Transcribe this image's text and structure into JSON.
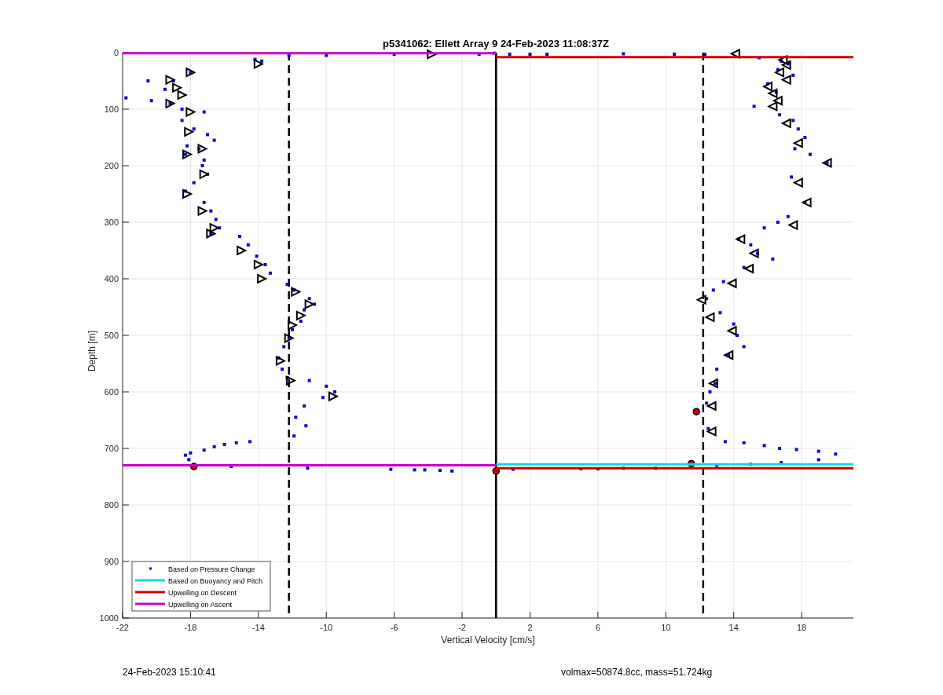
{
  "figure": {
    "footer_left": "24-Feb-2023 15:10:41",
    "footer_right": "volmax=50874.8cc, mass=51.724kg",
    "chart_data": {
      "type": "scatter",
      "title": "p5341062: Ellett Array 9 24-Feb-2023 11:08:37Z",
      "xlabel": "Vertical Velocity [cm/s]",
      "ylabel": "Depth [m]",
      "xlim": [
        -22,
        21.05
      ],
      "ylim": [
        1000,
        0
      ],
      "xticks": [
        -22,
        -18,
        -14,
        -10,
        -6,
        -2,
        2,
        6,
        10,
        14,
        18
      ],
      "yticks": [
        0,
        100,
        200,
        300,
        400,
        500,
        600,
        700,
        800,
        900,
        1000
      ],
      "series": [
        {
          "name": "Based on Pressure Change",
          "type": "scatter",
          "color": "#0a0ad0",
          "x": [
            -13.8,
            -14.2,
            -12.2,
            -18,
            -19,
            -20.5,
            -19.5,
            -21.8,
            -20.3,
            -19.2,
            -18.5,
            -17.2,
            -18.5,
            -17.8,
            -17,
            -16.6,
            -18.2,
            -17.5,
            -18.3,
            -17.2,
            -17.3,
            -17,
            -17.8,
            -18.3,
            -17.2,
            -16.8,
            -16.5,
            -16.3,
            -16.8,
            -15.1,
            -14.6,
            -14.1,
            -13.6,
            -13.3,
            -12.3,
            -11.9,
            -11,
            -10.7,
            -11.3,
            -11.5,
            -12,
            -12.2,
            -12.5,
            -12.8,
            -12.6,
            -12.3,
            -11,
            -10,
            -9.5,
            -10.2,
            -11.3,
            -11.8,
            -11.2,
            -11.9,
            -14.5,
            -15.3,
            -16,
            -16.6,
            -17.2,
            -18,
            -18.3,
            -18.1,
            -15.6,
            -11.1,
            -6.2,
            -4.8,
            -4.2,
            -3.3,
            -2.6,
            -0.1,
            -1,
            -6,
            -10,
            0.8,
            2,
            3,
            7.5,
            10.5,
            12.3,
            15.5,
            16.8,
            17.2,
            16.6,
            17.5,
            16,
            16.5,
            15.2,
            16.7,
            17.5,
            17.8,
            18.2,
            17.6,
            18.5,
            19.5,
            17.4,
            18.2,
            17.2,
            16.6,
            15.8,
            14.3,
            15,
            15.4,
            16.3,
            14.6,
            13.4,
            12.8,
            12.4,
            13.2,
            14,
            14.2,
            14.6,
            13.7,
            13,
            12.9,
            12.6,
            12.4,
            12.5,
            13.5,
            14.6,
            15.8,
            16.7,
            17.7,
            19,
            20,
            19,
            16.8,
            15,
            13,
            9.4,
            7.5,
            6,
            5,
            1
          ],
          "values": [
            15,
            12,
            5,
            35,
            50,
            50,
            65,
            80,
            85,
            90,
            100,
            105,
            120,
            135,
            145,
            155,
            165,
            170,
            180,
            190,
            200,
            215,
            230,
            245,
            265,
            280,
            295,
            310,
            320,
            325,
            340,
            360,
            375,
            390,
            410,
            420,
            435,
            445,
            455,
            475,
            490,
            505,
            520,
            540,
            560,
            575,
            580,
            590,
            600,
            610,
            625,
            645,
            660,
            678,
            688,
            690,
            693,
            697,
            703,
            708,
            712,
            720,
            732,
            735,
            737,
            738,
            738,
            739,
            740,
            1,
            3,
            3,
            5,
            3,
            3,
            3,
            2,
            3,
            3,
            9,
            15,
            20,
            30,
            40,
            55,
            70,
            95,
            110,
            120,
            135,
            150,
            170,
            180,
            195,
            220,
            265,
            290,
            300,
            310,
            330,
            340,
            355,
            365,
            380,
            405,
            420,
            435,
            460,
            480,
            500,
            520,
            535,
            560,
            585,
            600,
            620,
            665,
            688,
            690,
            695,
            700,
            702,
            705,
            710,
            720,
            725,
            728,
            730,
            735,
            735,
            736,
            736,
            737
          ]
        },
        {
          "name": "Based on Buoyancy and Pitch",
          "type": "line",
          "color": "#00e0e0",
          "x": [
            0,
            21.05
          ],
          "values": [
            728,
            728
          ]
        },
        {
          "name": "Upwelling on Descent",
          "type": "line",
          "color": "#cc0000",
          "x": [
            0,
            21.05
          ],
          "values": [
            735,
            735
          ]
        },
        {
          "name": "Upwelling on Ascent",
          "type": "line",
          "color": "#cc00cc",
          "x": [
            -22,
            0
          ],
          "values": [
            730,
            730
          ]
        },
        {
          "type": "line",
          "color": "#cc0000",
          "x": [
            0,
            21.05
          ],
          "values": [
            8,
            8
          ]
        },
        {
          "type": "line",
          "color": "#cc00cc",
          "x": [
            -22,
            0
          ],
          "values": [
            1,
            1
          ]
        },
        {
          "type": "scatter",
          "marker": "triangle",
          "color": "#000000",
          "x": [
            -14,
            -18,
            -19.2,
            -18.8,
            -18.5,
            -19.2,
            -18,
            -18.1,
            -17.3,
            -18.2,
            -17.2,
            -18.2,
            -17.3,
            -16.6,
            -16.8,
            -15,
            -14,
            -13.8,
            -11.8,
            -11,
            -11.5,
            -12,
            -12.2,
            -12.7,
            -12.1,
            -9.6,
            -3.8,
            14.1,
            16.9,
            17.1,
            16.7,
            17.1,
            16,
            16.3,
            16.6,
            16.3,
            17.1,
            17.8,
            19.5,
            17.8,
            18.3,
            17.5,
            14.4,
            15.2,
            14.9,
            13.9,
            12.1,
            12.6,
            13.9,
            13.7,
            12.8,
            12.7,
            12.7
          ],
          "values": [
            20,
            35,
            48,
            62,
            75,
            90,
            105,
            140,
            170,
            180,
            215,
            250,
            280,
            310,
            320,
            350,
            375,
            400,
            423,
            445,
            465,
            482,
            505,
            545,
            580,
            608,
            3,
            2,
            13,
            22,
            35,
            48,
            60,
            72,
            85,
            95,
            125,
            160,
            195,
            230,
            265,
            305,
            330,
            355,
            382,
            408,
            437,
            468,
            492,
            535,
            585,
            625,
            670
          ]
        },
        {
          "type": "scatter",
          "marker": "circle",
          "color": "#cc0000",
          "x": [
            11.8,
            11.5,
            0,
            -17.8
          ],
          "values": [
            635,
            727,
            740,
            732
          ]
        }
      ],
      "ref_lines": [
        {
          "axis": "x",
          "value": -12.2,
          "color": "#000000"
        },
        {
          "axis": "x",
          "value": 12.2,
          "color": "#000000"
        },
        {
          "axis": "x",
          "value": 0,
          "color": "#000000"
        }
      ],
      "grid": true,
      "legend": true
    }
  }
}
